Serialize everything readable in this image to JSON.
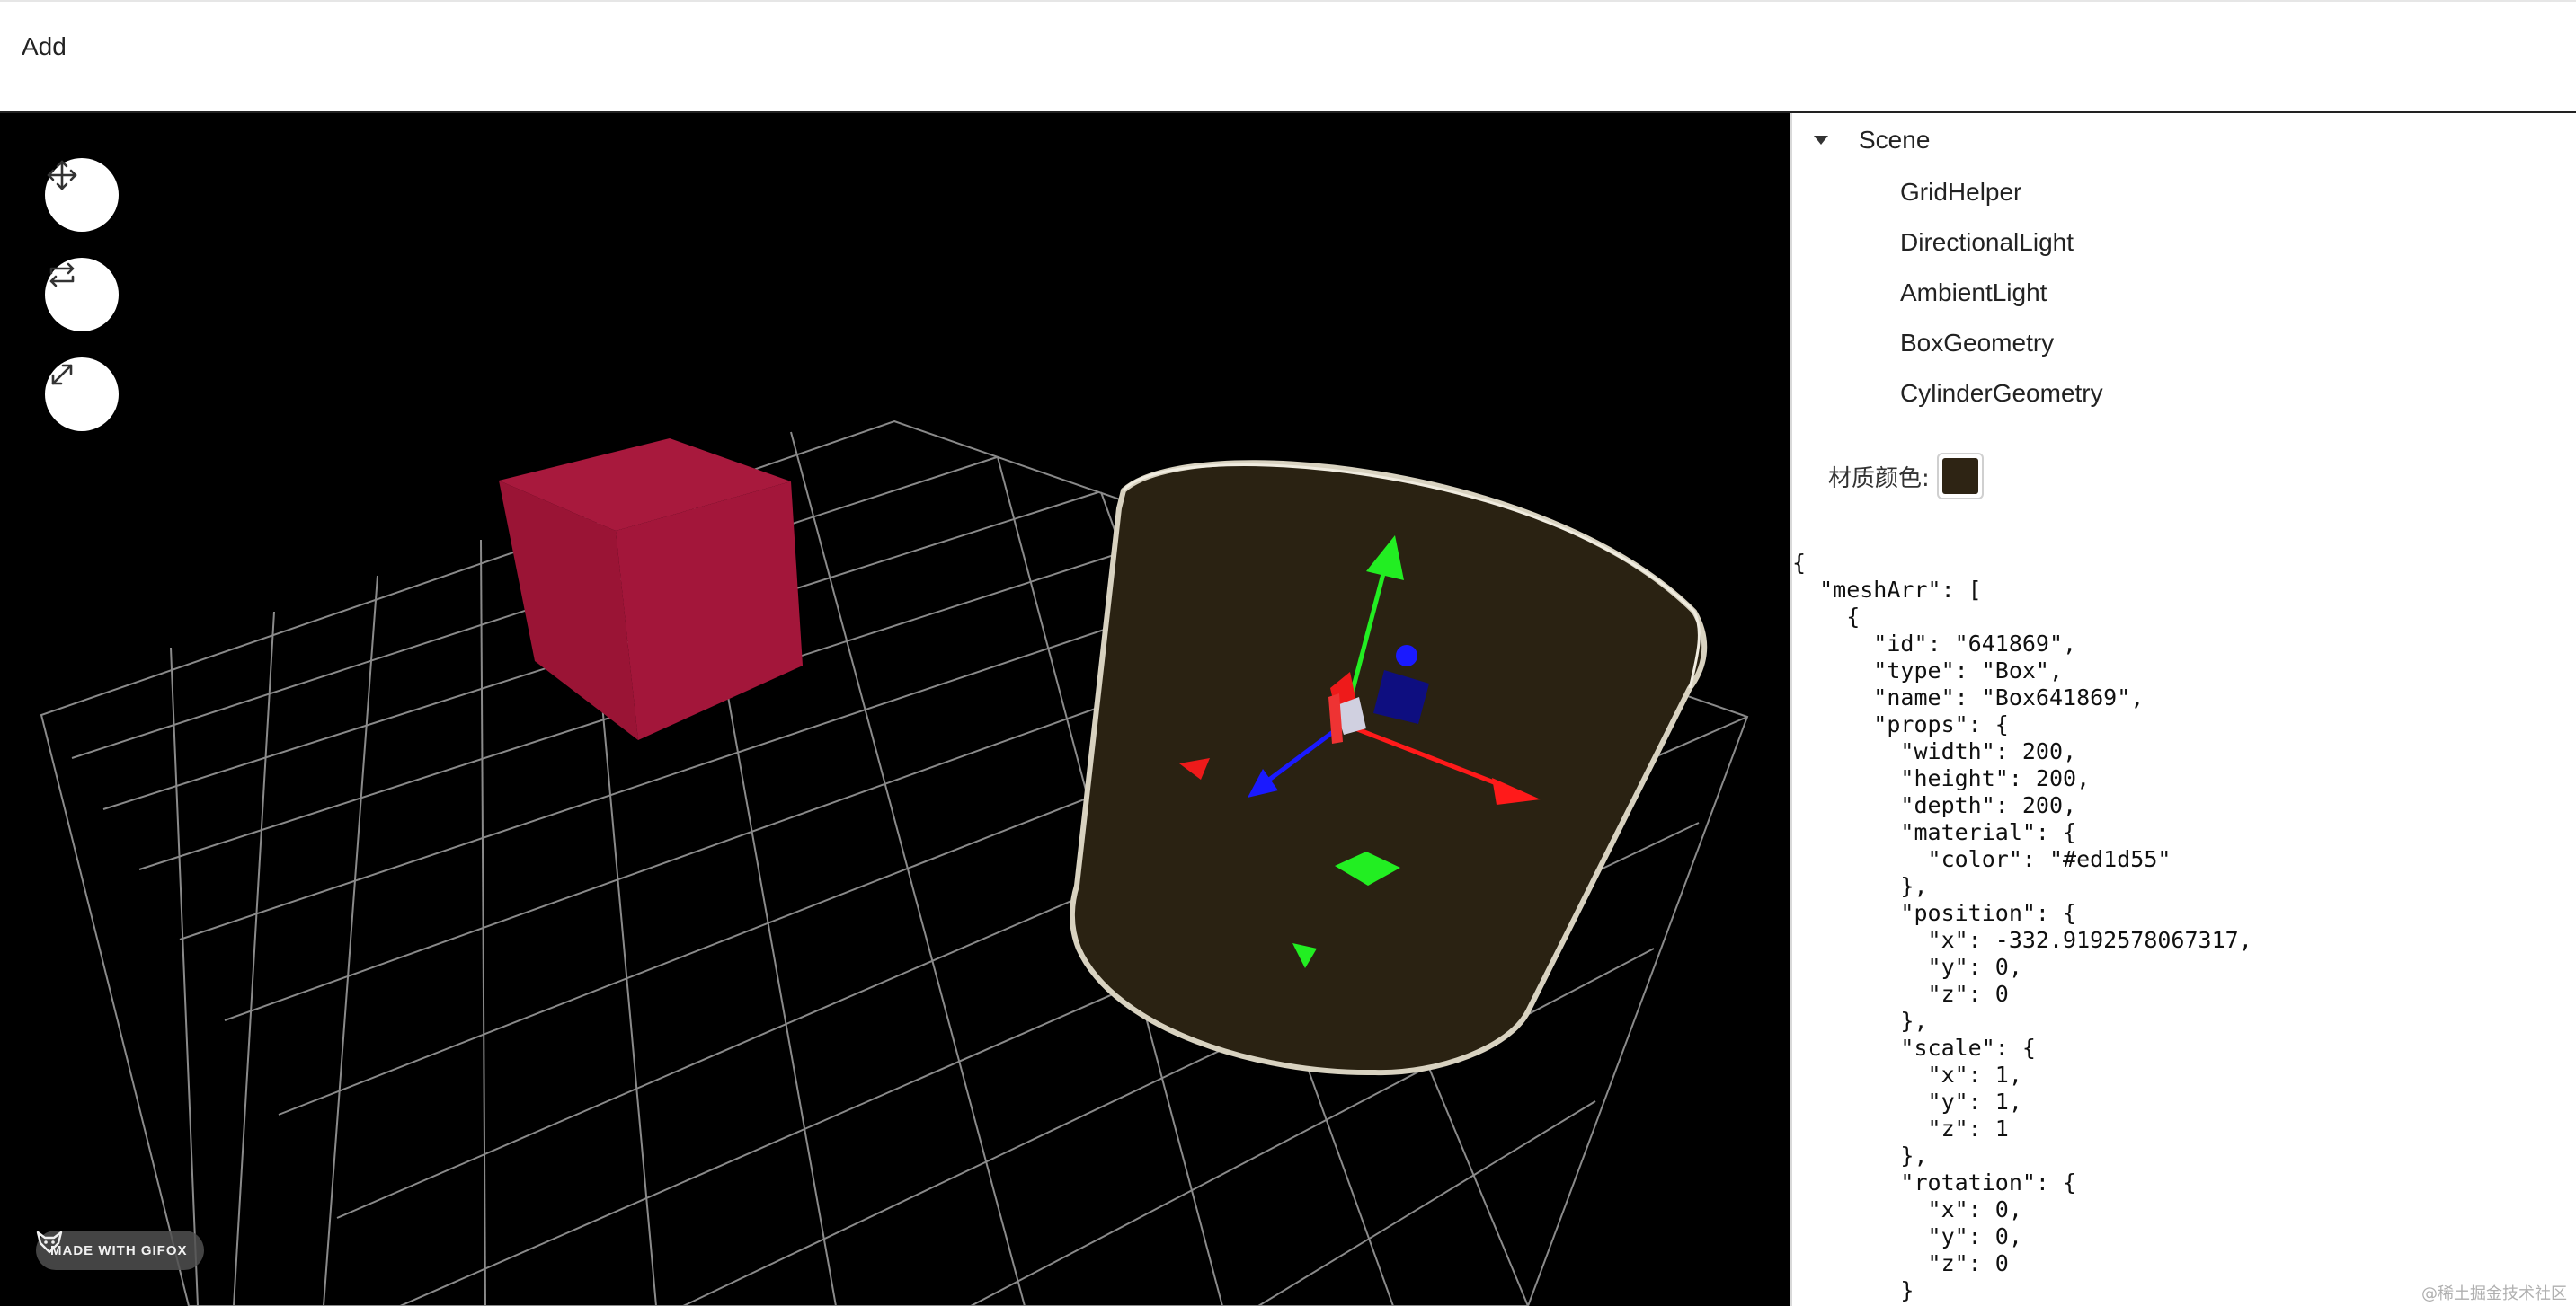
{
  "menu": {
    "add_label": "Add"
  },
  "toolbar": {
    "translate_icon": "move-arrows-icon",
    "rotate_icon": "repeat-arrows-icon",
    "scale_icon": "expand-diagonal-icon"
  },
  "viewport": {
    "background": "#000000",
    "box_color": "#a3163a",
    "cylinder_color": "#2a2212",
    "cylinder_outline": "#d8d2c0",
    "gizmo_colors": {
      "x": "#ff1a1a",
      "y": "#22ee22",
      "z": "#1a1aff"
    },
    "badge_text": "MADE WITH GIFOX",
    "badge_icon": "gifox-fox-icon"
  },
  "scene_tree": {
    "root_label": "Scene",
    "children": [
      "GridHelper",
      "DirectionalLight",
      "AmbientLight",
      "BoxGeometry",
      "CylinderGeometry"
    ]
  },
  "material": {
    "label": "材质颜色:",
    "color": "#2e2414"
  },
  "json_panel": {
    "text": "{\n  \"meshArr\": [\n    {\n      \"id\": \"641869\",\n      \"type\": \"Box\",\n      \"name\": \"Box641869\",\n      \"props\": {\n        \"width\": 200,\n        \"height\": 200,\n        \"depth\": 200,\n        \"material\": {\n          \"color\": \"#ed1d55\"\n        },\n        \"position\": {\n          \"x\": -332.9192578067317,\n          \"y\": 0,\n          \"z\": 0\n        },\n        \"scale\": {\n          \"x\": 1,\n          \"y\": 1,\n          \"z\": 1\n        },\n        \"rotation\": {\n          \"x\": 0,\n          \"y\": 0,\n          \"z\": 0\n        }"
  },
  "watermark": "@稀土掘金技术社区"
}
